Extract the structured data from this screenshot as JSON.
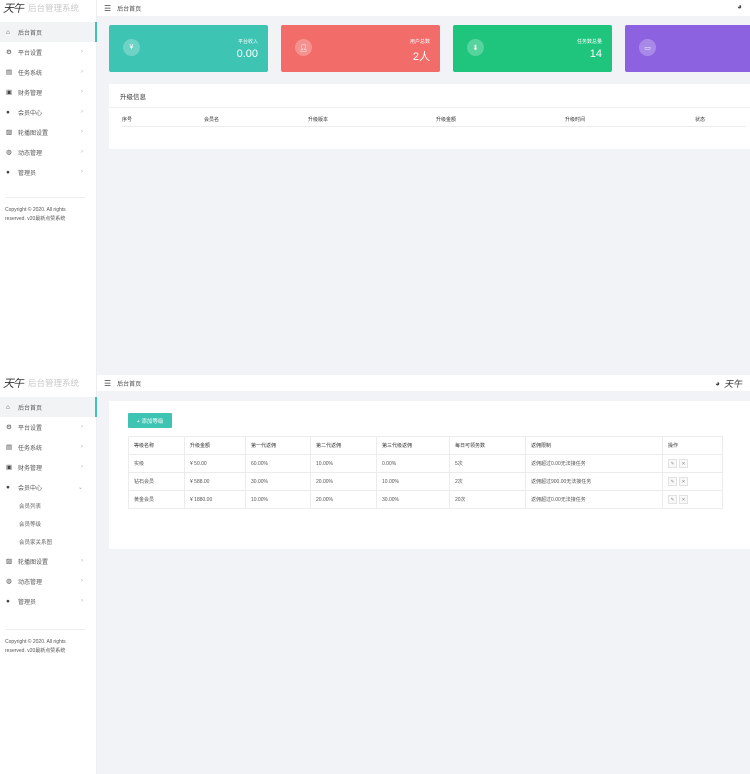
{
  "brand": {
    "logo_text": "天午",
    "name": "后台管理系统"
  },
  "topbar": {
    "breadcrumb": "后台首页",
    "avatar_text": "天午"
  },
  "nav": {
    "home": "后台首页",
    "platform": "平台设置",
    "tasks": "任务系统",
    "finance": "财务管理",
    "members": "会员中心",
    "banners": "轮播图设置",
    "news": "动态管理",
    "admins": "管理员"
  },
  "member_submenu": [
    "会员列表",
    "会员等级",
    "会员家关系图"
  ],
  "copyright": "Copyright © 2020. All rights reserved. v20最新点赞系统",
  "stats": [
    {
      "label": "平台收入",
      "value": "0.00",
      "icon": "¥",
      "color": "#3ec4b3"
    },
    {
      "label": "用户总数",
      "value": "2人",
      "icon": "user",
      "color": "#f26c6a"
    },
    {
      "label": "任务数总量",
      "value": "14",
      "icon": "download",
      "color": "#1fc47d"
    },
    {
      "label": "",
      "value": "",
      "icon": "chat",
      "color": "#8d62e0"
    }
  ],
  "upgrade": {
    "title": "升级信息",
    "columns": [
      "序号",
      "会员名",
      "升级版本",
      "升级金额",
      "升级时间",
      "状态"
    ]
  },
  "levels": {
    "add_button": "+ 添加等级",
    "columns": [
      "等级名称",
      "升级金额",
      "第一代返佣",
      "第二代返佣",
      "第三代级返佣",
      "每日可领务数",
      "返佣限制",
      "操作"
    ],
    "rows": [
      [
        "实级",
        "¥ 50.00",
        "60.00%",
        "10.00%",
        "0.00%",
        "5次",
        "返佣超过0.00无法接任务"
      ],
      [
        "钻石会员",
        "¥ 588.00",
        "30.00%",
        "20.00%",
        "10.00%",
        "2次",
        "返佣超过900.00无法接任务"
      ],
      [
        "黄金会员",
        "¥ 1880.00",
        "10.00%",
        "20.00%",
        "30.00%",
        "20次",
        "返佣超过0.00无法接任务"
      ]
    ]
  }
}
